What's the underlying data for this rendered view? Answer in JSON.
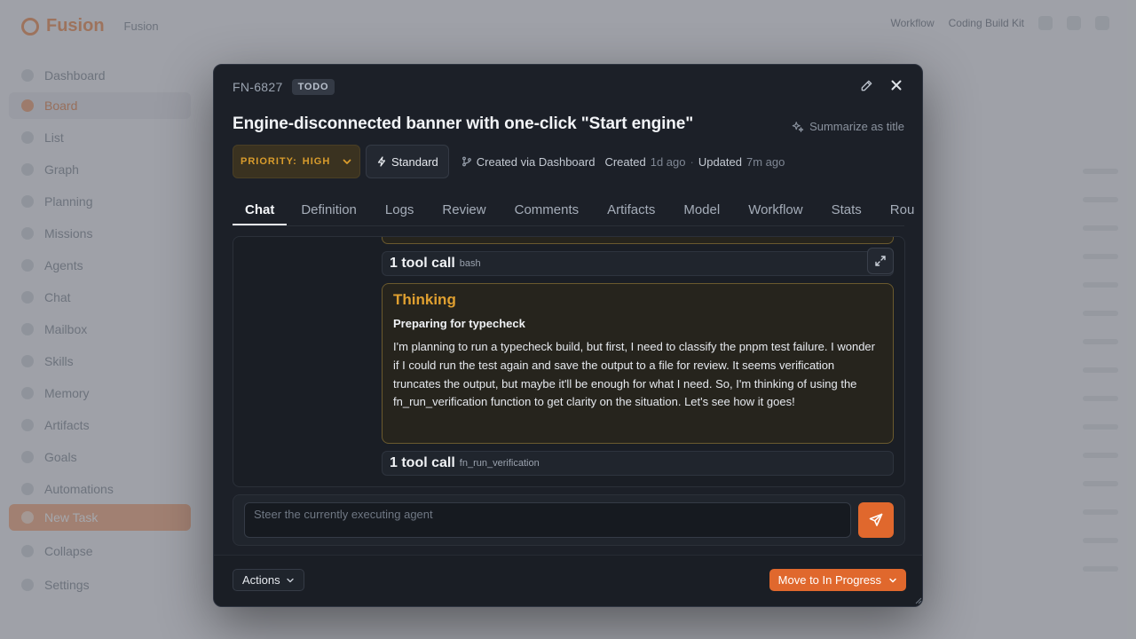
{
  "background": {
    "logo_text": "Fusion",
    "project": "Fusion",
    "top_right_label": "Workflow",
    "top_right_project": "Coding Build Kit",
    "nav_items": [
      "Dashboard",
      "Board",
      "List",
      "Graph",
      "Planning",
      "Missions",
      "Agents",
      "Chat",
      "Mailbox",
      "Skills",
      "Memory",
      "Artifacts",
      "Goals",
      "Automations"
    ],
    "new_task_label": "New Task",
    "collapse_label": "Collapse",
    "settings_label": "Settings"
  },
  "modal": {
    "task_id": "FN-6827",
    "status": "TODO",
    "title": "Engine-disconnected banner with one-click \"Start engine\"",
    "summarize_label": "Summarize as title",
    "priority_label": "PRIORITY:",
    "priority_value": "HIGH",
    "mode_label": "Standard",
    "created_via": "Created via Dashboard",
    "created_label": "Created",
    "created_ago": "1d ago",
    "separator": "·",
    "updated_label": "Updated",
    "updated_ago": "7m ago",
    "tabs": [
      "Chat",
      "Definition",
      "Logs",
      "Review",
      "Comments",
      "Artifacts",
      "Model",
      "Workflow",
      "Stats",
      "Rou"
    ],
    "active_tab": "Chat"
  },
  "chat": {
    "tool_call_1": {
      "count": "1 tool call",
      "name": "bash"
    },
    "thinking": {
      "title": "Thinking",
      "subtitle": "Preparing for typecheck",
      "body": "I'm planning to run a typecheck build, but first, I need to classify the pnpm test failure. I wonder if I could run the test again and save the output to a file for review. It seems verification truncates the output, but maybe it'll be enough for what I need. So, I'm thinking of using the fn_run_verification function to get clarity on the situation. Let's see how it goes!"
    },
    "tool_call_2": {
      "count": "1 tool call",
      "name": "fn_run_verification"
    },
    "input_placeholder": "Steer the currently executing agent",
    "input_value": ""
  },
  "footer": {
    "actions_label": "Actions",
    "move_label": "Move to In Progress"
  },
  "colors": {
    "accent": "#e0682d",
    "priority": "#d99c2c",
    "thinking_border": "#6b5a2e",
    "modal_bg": "#1c2028"
  }
}
